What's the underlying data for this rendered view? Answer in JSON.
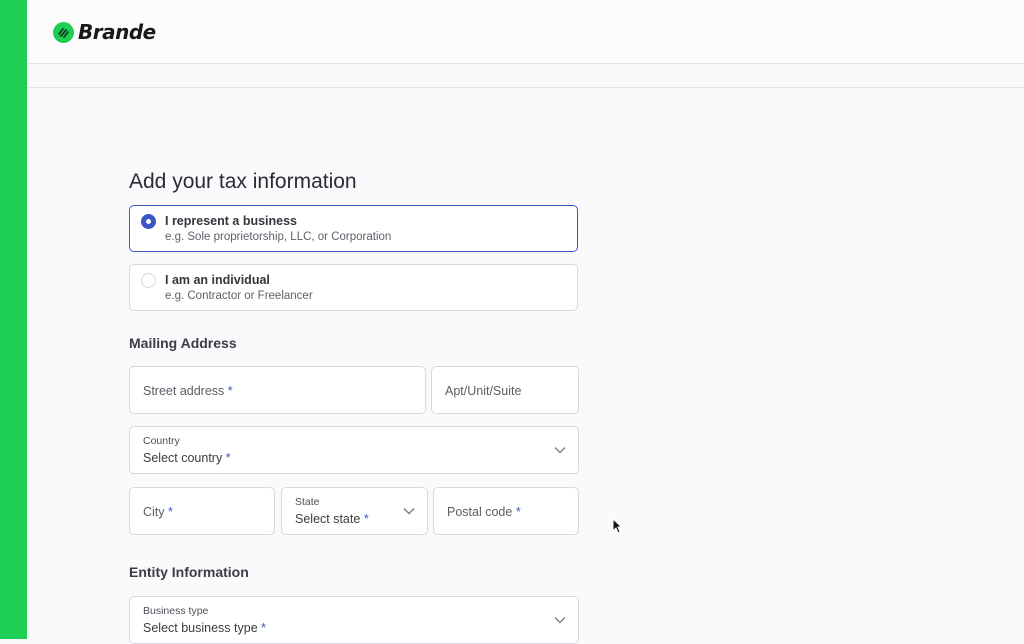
{
  "brand": {
    "name": "Brande",
    "accent": "#1fcf55",
    "icon": "brand-logo-icon"
  },
  "form": {
    "title": "Add your tax information",
    "options": [
      {
        "label": "I represent a business",
        "description": "e.g. Sole proprietorship, LLC, or Corporation",
        "selected": true
      },
      {
        "label": "I am an individual",
        "description": "e.g. Contractor or Freelancer",
        "selected": false
      }
    ],
    "mailing": {
      "heading": "Mailing Address",
      "street_placeholder": "Street address",
      "apt_placeholder": "Apt/Unit/Suite",
      "country_label": "Country",
      "country_placeholder": "Select country",
      "city_placeholder": "City",
      "state_label": "State",
      "state_placeholder": "Select state",
      "postal_placeholder": "Postal code",
      "required_mark": "*"
    },
    "entity": {
      "heading": "Entity Information",
      "business_type_label": "Business type",
      "business_type_placeholder": "Select business type"
    }
  },
  "colors": {
    "primary": "#3d56c5",
    "border": "#d6d9de"
  }
}
